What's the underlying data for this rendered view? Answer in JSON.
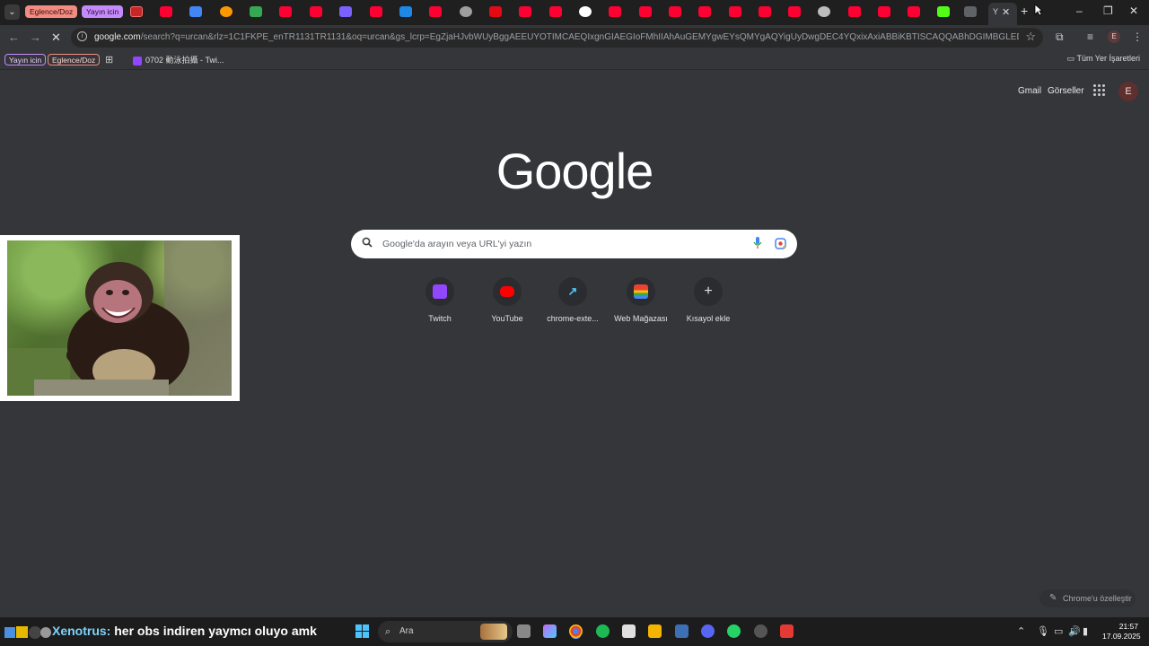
{
  "tabs": {
    "groups": [
      {
        "label": "Eglence/Doz",
        "color": "#f28b82"
      },
      {
        "label": "Yayın icin",
        "color": "#c58af9"
      }
    ],
    "active_tab_label": "Y",
    "close_glyph": "✕",
    "new_tab_glyph": "+"
  },
  "toolbar": {
    "url_host": "google.com",
    "url_rest": "/search?q=urcan&rlz=1C1FKPE_enTR1131TR1131&oq=urcan&gs_lcrp=EgZjaHJvbWUyBggAEEUYOTIMCAEQIxgnGIAEGIoFMhIIAhAuGEMYgwEYsQMYgAQYigUyDwgDEC4YQxixAxiABBiKBTISCAQQABhDGIMBGLEDGIAEGIoFMgwIBRAuGEMY..."
  },
  "bookmarks": {
    "group_yayin": "Yayın icin",
    "group_eglence": "Eglence/Doz",
    "item": "0702 動泳拍攝 - Twi...",
    "all_bookmarks": "Tüm Yer İşaretleri"
  },
  "page": {
    "links": {
      "gmail": "Gmail",
      "images": "Görseller"
    },
    "account_initial": "E",
    "logo": "Google",
    "search_placeholder": "Google'da arayın veya URL'yi yazın",
    "shortcuts": [
      {
        "label": "Twitch",
        "icon": "twitch-icon",
        "color": "#9146ff"
      },
      {
        "label": "YouTube",
        "icon": "youtube-icon",
        "color": "#ff0000"
      },
      {
        "label": "chrome-exte...",
        "icon": "extension-icon",
        "color": "#4fc3f7"
      },
      {
        "label": "Web Mağazası",
        "icon": "webstore-icon",
        "color": "#ea4335"
      },
      {
        "label": "Kısayol ekle",
        "icon": "plus-icon",
        "color": "#e3e3e3"
      }
    ],
    "customize_label": "Chrome'u özelleştir"
  },
  "taskbar": {
    "chat_nick": "Xenotrus:",
    "chat_message": "her obs indiren yaymcı oluyo amk",
    "search_label": "Ara",
    "time": "21:57",
    "date": "17.09.2025"
  }
}
